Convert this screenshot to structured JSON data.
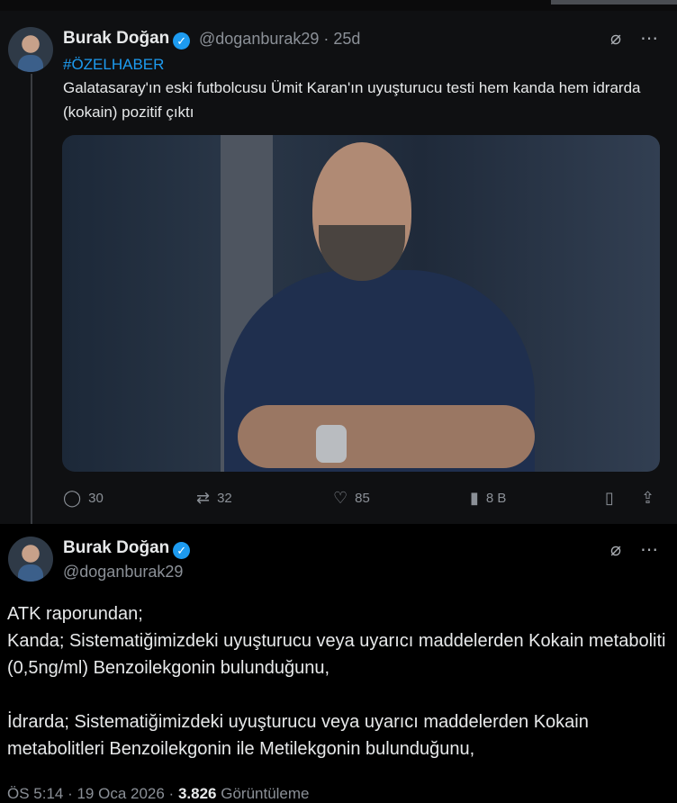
{
  "tweet1": {
    "author": "Burak Doğan",
    "handle": "@doganburak29",
    "separator": "·",
    "age": "25d",
    "hashtag": "#ÖZELHABER",
    "text": "Galatasaray'ın eski futbolcusu Ümit Karan'ın uyuşturucu testi hem kanda hem idrarda (kokain) pozitif çıktı",
    "actions": {
      "replies": "30",
      "retweets": "32",
      "likes": "85",
      "views": "8 B"
    }
  },
  "tweet2": {
    "author": "Burak Doğan",
    "handle": "@doganburak29",
    "lines": [
      "ATK raporundan;",
      "Kanda; Sistematiğimizdeki uyuşturucu veya uyarıcı maddelerden Kokain metaboliti (0,5ng/ml) Benzoilekgonin bulunduğunu,",
      "İdrarda; Sistematiğimizdeki uyuşturucu veya uyarıcı maddelerden Kokain metabolitleri Benzoilekgonin ile Metilekgonin bulunduğunu,"
    ],
    "meta": {
      "time_date": "ÖS 5:14 · 19 Oca 2026 ·",
      "views_count": "3.826",
      "views_label": "Görüntüleme"
    }
  },
  "icons": {
    "verified": "verified-badge-icon",
    "grok": "grok-icon",
    "more": "more-icon",
    "reply": "reply-icon",
    "retweet": "retweet-icon",
    "like": "like-icon",
    "views": "views-icon",
    "bookmark": "bookmark-icon",
    "share": "share-icon"
  },
  "colors": {
    "accent": "#1d9bf0",
    "muted": "#8b9097",
    "text": "#e7e9ea"
  }
}
